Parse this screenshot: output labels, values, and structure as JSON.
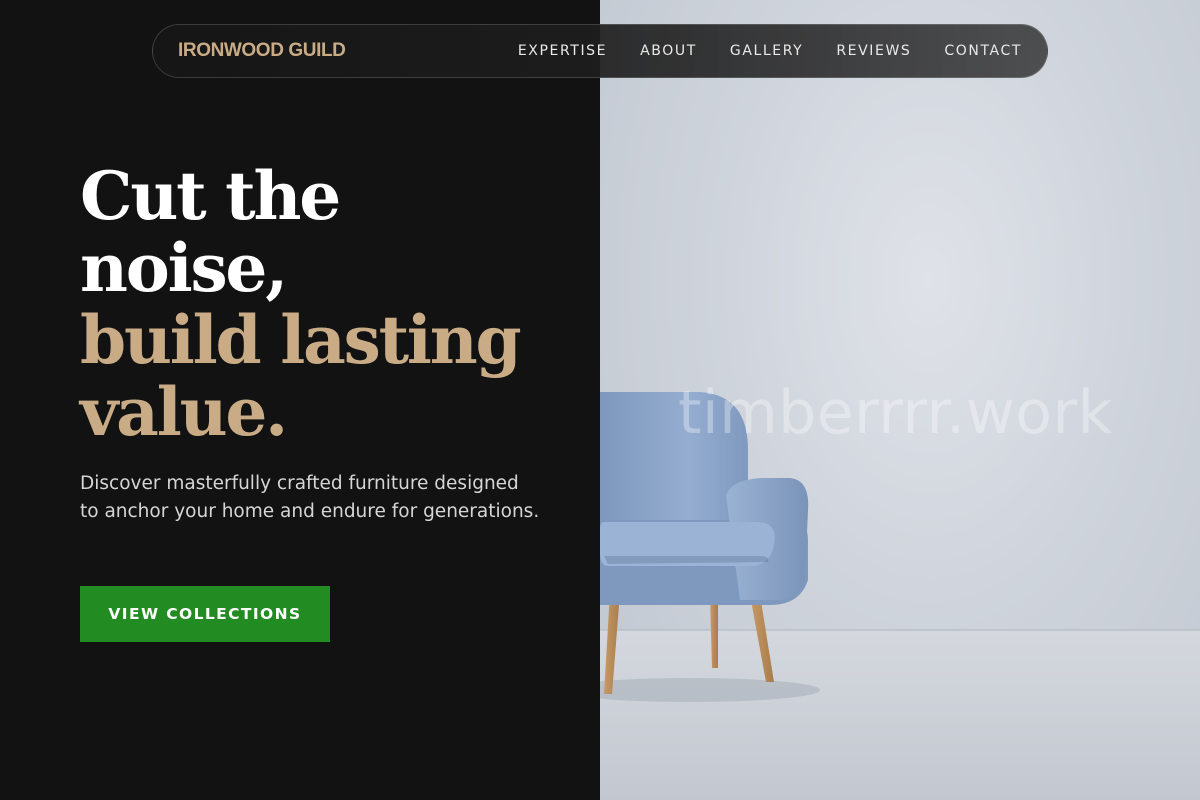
{
  "header": {
    "logo": "IRONWOOD GUILD",
    "nav": [
      {
        "label": "EXPERTISE"
      },
      {
        "label": "ABOUT"
      },
      {
        "label": "GALLERY"
      },
      {
        "label": "REVIEWS"
      },
      {
        "label": "CONTACT"
      }
    ]
  },
  "hero": {
    "title_lines": [
      "Cut the",
      "noise,",
      "build lasting",
      "value."
    ],
    "description": "Discover masterfully crafted furniture designed to anchor your home and endure for generations.",
    "cta_label": "VIEW COLLECTIONS"
  },
  "image": {
    "subject": "armchair-photo",
    "watermark": "timberrrr.work"
  },
  "colors": {
    "background": "#121212",
    "accent_gold": "#c9ac86",
    "cta_green": "#228b22",
    "chair_blue": "#8faad0"
  }
}
